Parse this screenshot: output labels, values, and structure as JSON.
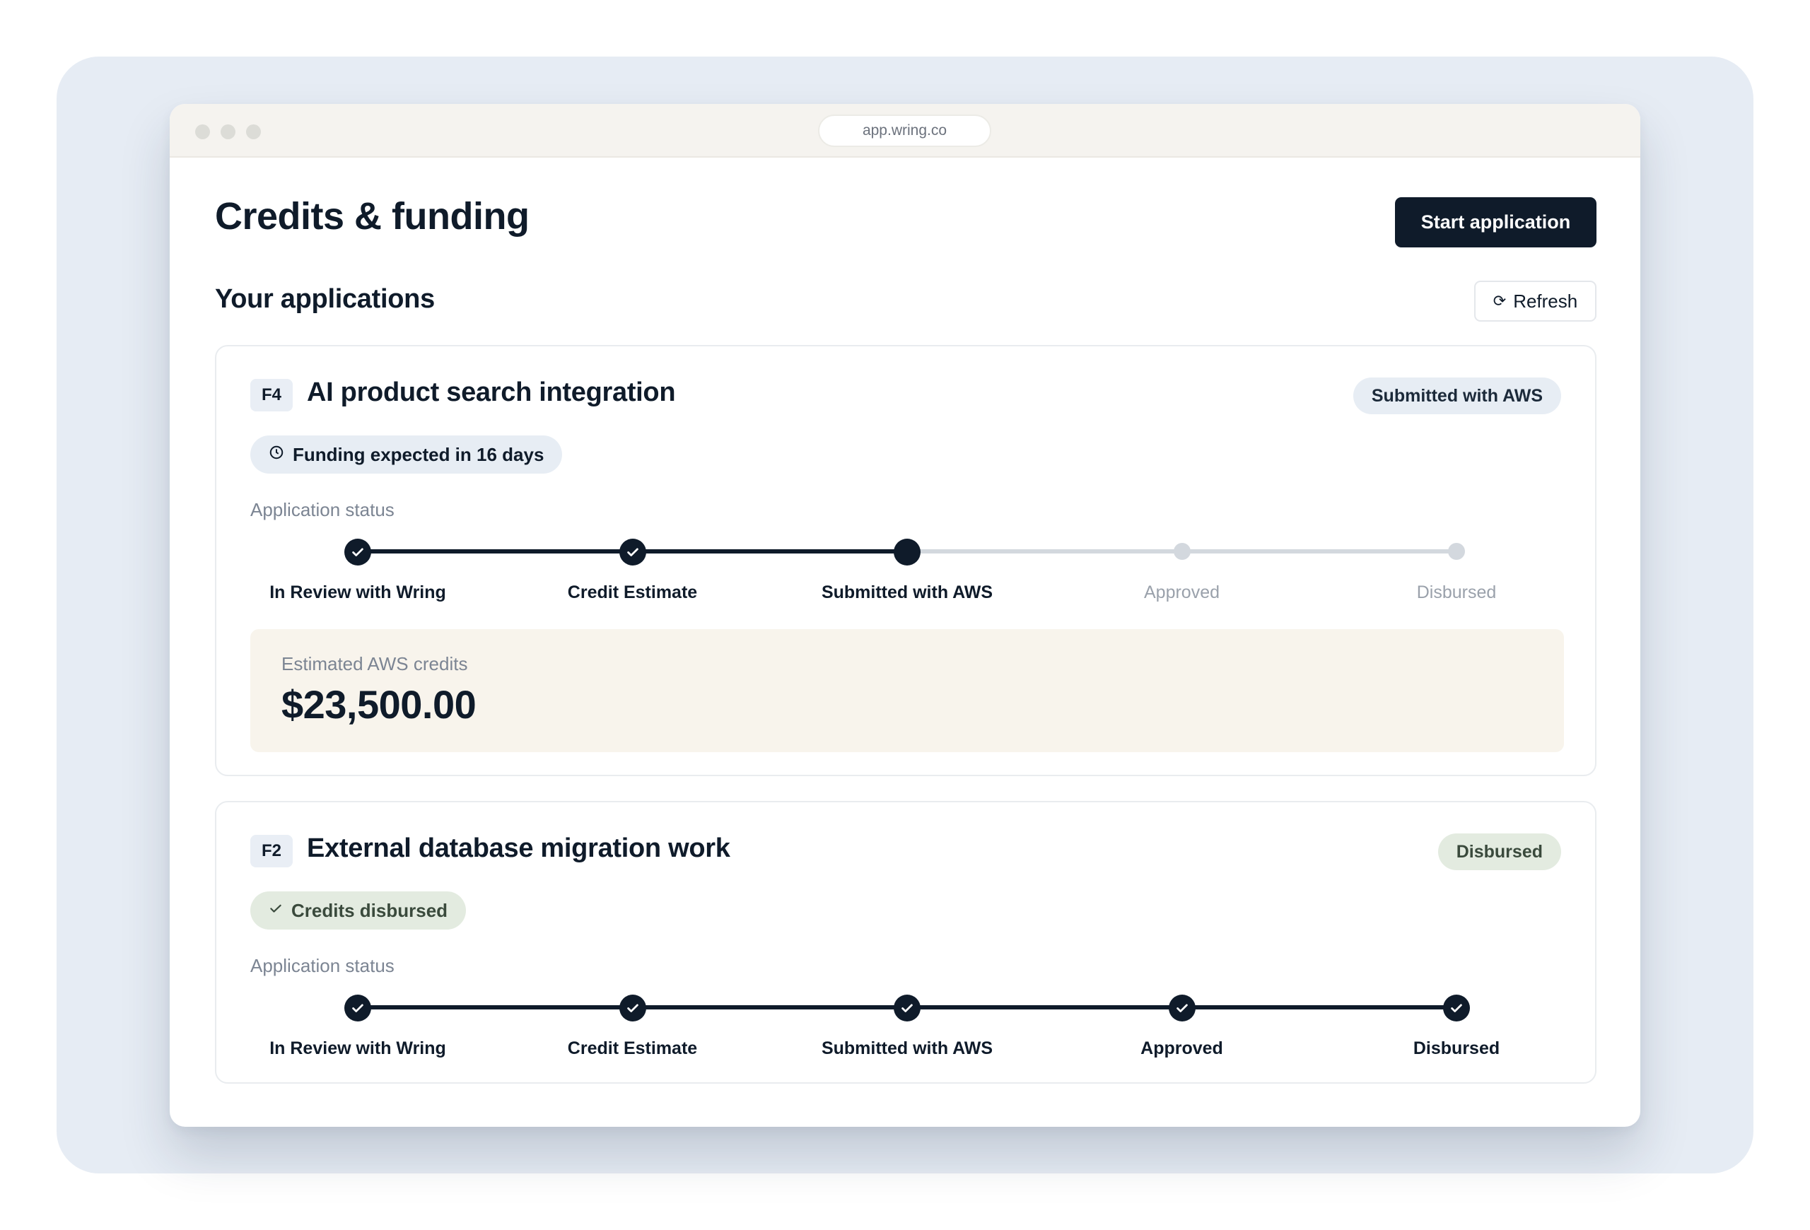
{
  "browser": {
    "url": "app.wring.co"
  },
  "page": {
    "title": "Credits & funding",
    "start_button": "Start application",
    "section_title": "Your applications",
    "refresh_button": "Refresh"
  },
  "applications": [
    {
      "code": "F4",
      "title": "AI product search integration",
      "status_badge": "Submitted with AWS",
      "info_pill": "Funding expected in 16 days",
      "status_label": "Application status",
      "steps": [
        "In Review with Wring",
        "Credit Estimate",
        "Submitted with AWS",
        "Approved",
        "Disbursed"
      ],
      "completed_steps": 2,
      "current_step_index": 2,
      "estimate_label": "Estimated AWS credits",
      "estimate_value": "$23,500.00"
    },
    {
      "code": "F2",
      "title": "External database migration work",
      "status_badge": "Disbursed",
      "info_pill": "Credits disbursed",
      "status_label": "Application status",
      "steps": [
        "In Review with Wring",
        "Credit Estimate",
        "Submitted with AWS",
        "Approved",
        "Disbursed"
      ],
      "completed_steps": 5,
      "current_step_index": 4
    }
  ],
  "colors": {
    "primary": "#0f1b2a",
    "badge_submitted_bg": "#e7edf4",
    "badge_disbursed_bg": "#e3ebe0",
    "pending_gray": "#d3d8de",
    "pending_text": "#9aa1ab",
    "estimate_bg": "#f8f4ec"
  },
  "icons": {
    "refresh": "refresh-icon",
    "clock": "clock-icon",
    "check": "check-icon",
    "step_check": "check-circle-icon"
  }
}
